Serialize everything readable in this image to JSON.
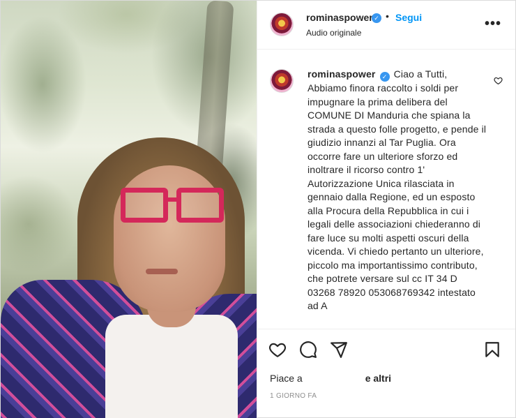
{
  "post": {
    "username": "rominaspower",
    "verified_mark": "✓",
    "dot": "•",
    "follow_label": "Segui",
    "audio_label": "Audio originale",
    "more_label": "•••",
    "caption_text": "Ciao a Tutti, Abbiamo finora raccolto i soldi per impugnare la prima delibera del COMUNE DI Manduria che spiana la strada a questo folle progetto, e pende il giudizio innanzi al Tar Puglia. Ora occorre fare un ulteriore sforzo ed inoltrare il ricorso contro 1' Autorizzazione Unica rilasciata in gennaio dalla Regione, ed un esposto alla Procura della Repubblica in cui i legali delle associazioni chiederanno di fare luce su molti aspetti oscuri della vicenda. Vi chiedo pertanto un ulteriore, piccolo ma importantissimo contributo, che potrete versare sul cc IT 34 D 03268 78920 053068769342 intestato ad A"
  },
  "engagement": {
    "likes_prefix": "Piace a",
    "likes_suffix": "e altri",
    "timestamp": "1 GIORNO FA"
  },
  "icons": {
    "like": "heart-icon",
    "comment": "comment-icon",
    "share": "share-icon",
    "save": "bookmark-icon",
    "caption_like": "heart-small-icon"
  },
  "colors": {
    "accent": "#0095f6",
    "verified": "#3897f0",
    "text": "#262626",
    "muted": "#8e8e8e"
  }
}
